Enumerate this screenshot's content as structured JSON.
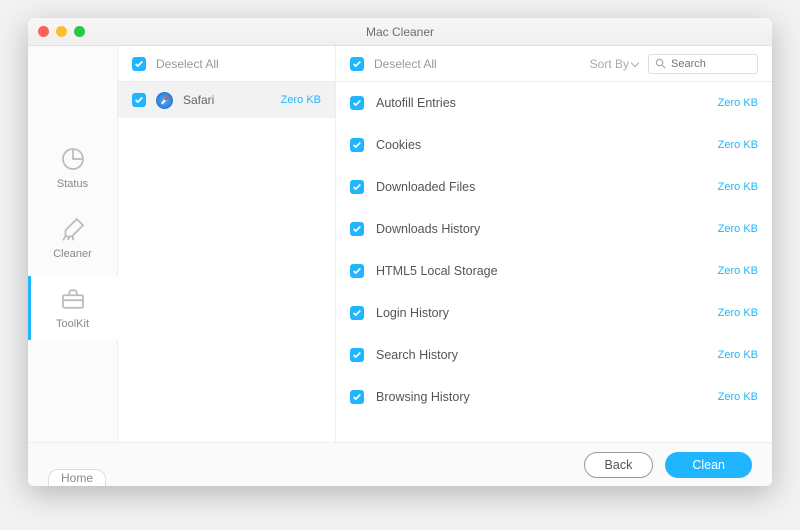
{
  "title": "Mac Cleaner",
  "sidebar": {
    "items": [
      {
        "label": "Status"
      },
      {
        "label": "Cleaner"
      },
      {
        "label": "ToolKit"
      }
    ],
    "activeIndex": 2
  },
  "left": {
    "deselect": "Deselect All",
    "browsers": [
      {
        "name": "Safari",
        "size": "Zero KB"
      }
    ]
  },
  "right": {
    "deselect": "Deselect All",
    "sortby": "Sort By",
    "search_placeholder": "Search",
    "items": [
      {
        "label": "Autofill Entries",
        "size": "Zero KB"
      },
      {
        "label": "Cookies",
        "size": "Zero KB"
      },
      {
        "label": "Downloaded Files",
        "size": "Zero KB"
      },
      {
        "label": "Downloads History",
        "size": "Zero KB"
      },
      {
        "label": "HTML5 Local Storage",
        "size": "Zero KB"
      },
      {
        "label": "Login History",
        "size": "Zero KB"
      },
      {
        "label": "Search History",
        "size": "Zero KB"
      },
      {
        "label": "Browsing History",
        "size": "Zero KB"
      }
    ]
  },
  "footer": {
    "home": "Home",
    "back": "Back",
    "clean": "Clean"
  }
}
